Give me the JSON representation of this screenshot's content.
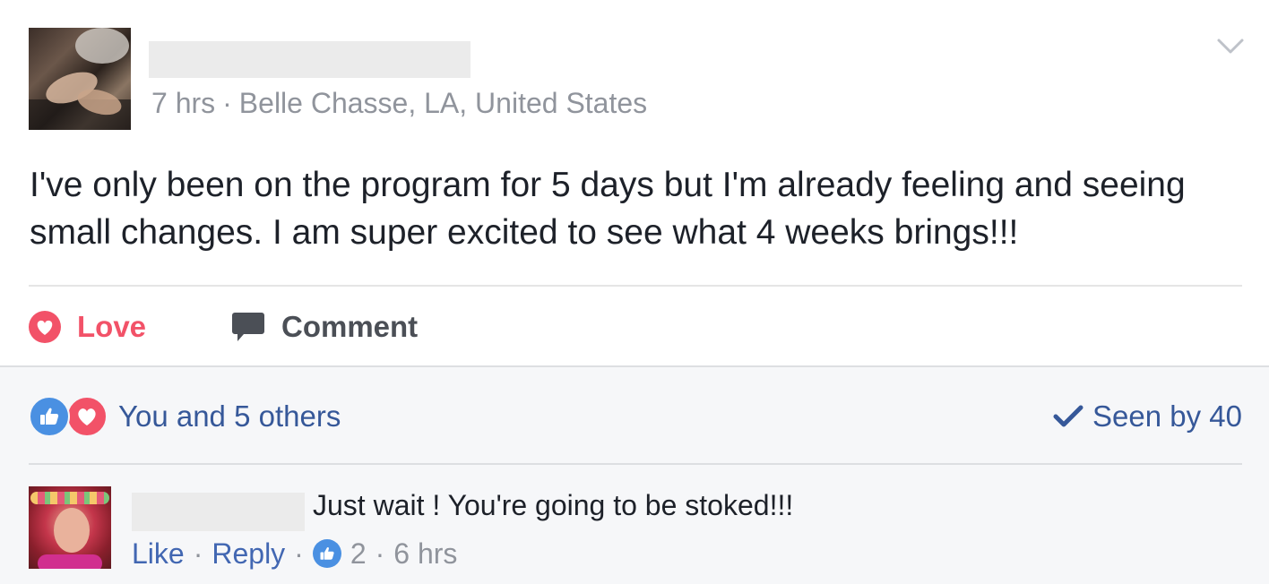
{
  "post": {
    "meta": {
      "time": "7 hrs",
      "separator": "·",
      "location": "Belle Chasse, LA, United States"
    },
    "text": "I've only been on the program for 5 days but I'm already feeling and seeing small changes. I am super excited to see what 4 weeks brings!!!"
  },
  "actions": {
    "love_label": "Love",
    "comment_label": "Comment"
  },
  "feedback": {
    "reactions_label": "You and 5 others",
    "seen_label": "Seen by 40"
  },
  "comment": {
    "text": "Just wait ! You're going to be stoked!!!",
    "like_label": "Like",
    "reply_label": "Reply",
    "separator": "·",
    "like_count": "2",
    "time": "6 hrs"
  },
  "colors": {
    "love": "#f25268",
    "link": "#4267b2",
    "like_blue": "#4a90e2",
    "meta_gray": "#90949c",
    "feedback_bg": "#f6f7f9"
  },
  "icons": {
    "menu": "chevron-down-icon",
    "love": "heart-icon",
    "comment": "speech-bubble-icon",
    "like_reaction": "thumbs-up-icon",
    "love_reaction": "heart-icon",
    "seen": "checkmark-icon"
  }
}
